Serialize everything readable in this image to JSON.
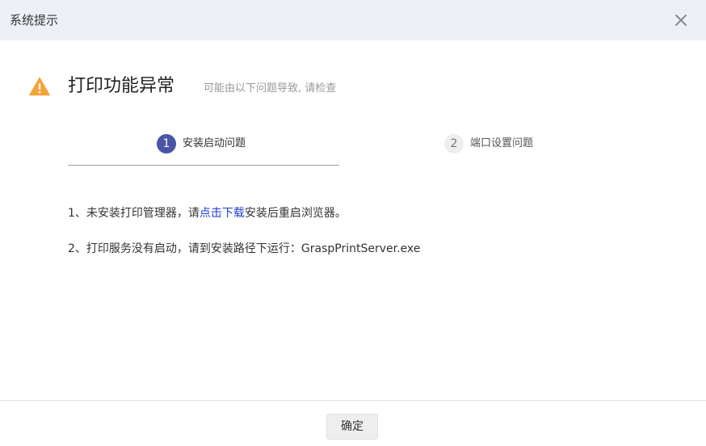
{
  "titlebar": {
    "title": "系统提示",
    "close_icon": "close-icon"
  },
  "header": {
    "icon": "warning-icon",
    "icon_color": "#f5a43a",
    "title": "打印功能异常",
    "subtitle": "可能由以下问题导致, 请检查"
  },
  "steps": [
    {
      "number": "1",
      "label": "安装启动问题",
      "active": true
    },
    {
      "number": "2",
      "label": "端口设置问题",
      "active": false
    }
  ],
  "content": {
    "line1_prefix": "1、未安装打印管理器，请",
    "line1_link": "点击下载",
    "line1_suffix": "安装后重启浏览器。",
    "line2": "2、打印服务没有启动，请到安装路径下运行：GraspPrintServer.exe"
  },
  "footer": {
    "ok_label": "确定"
  },
  "colors": {
    "accent": "#4a55a6",
    "link": "#1a3fd0",
    "titlebar_bg": "#eef0f7"
  }
}
